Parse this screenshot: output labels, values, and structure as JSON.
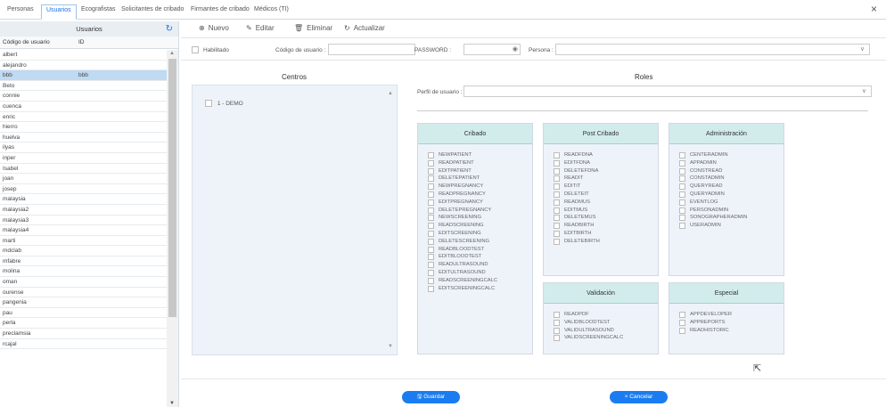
{
  "tabs": [
    "Personas",
    "Usuarios",
    "Ecografistas",
    "Solicitantes de cribado",
    "Firmantes de cribado",
    "Médicos (TI)"
  ],
  "active_tab": "Usuarios",
  "close_glyph": "×",
  "left": {
    "title": "Usuarios",
    "col_user": "Código de usuario",
    "col_id": "ID",
    "users": [
      "albert",
      "alejandro",
      "bbb",
      "Beto",
      "connie",
      "cuenca",
      "enric",
      "hierro",
      "huelva",
      "ilyas",
      "inper",
      "Isabel",
      "joan",
      "josep",
      "malaysia",
      "malaysia2",
      "malaysia3",
      "malaysia4",
      "marti",
      "mdclab",
      "mfabre",
      "molina",
      "oman",
      "ourense",
      "pangenia",
      "pau",
      "perla",
      "preclamsia",
      "rcajal"
    ],
    "selected_user": "bbb",
    "selected_id": "bbb"
  },
  "toolbar": {
    "new": "Nuevo",
    "edit": "Editar",
    "delete": "Eliminar",
    "refresh": "Actualizar"
  },
  "form": {
    "enabled_label": "Habilitado",
    "user_code_label": "Código de usuario :",
    "password_label": "PASSWORD :",
    "person_label": "Persona :",
    "profile_label": "Perfil de usuario :"
  },
  "centros": {
    "title": "Centros",
    "items": [
      "1 - DEMO"
    ]
  },
  "roles": {
    "title": "Roles",
    "groups": [
      {
        "name": "Cribado",
        "items": [
          "NEWPATIENT",
          "READPATIENT",
          "EDITPATIENT",
          "DELETEPATIENT",
          "NEWPREGNANCY",
          "READPREGNANCY",
          "EDITPREGNANCY",
          "DELETEPREGNANCY",
          "NEWSCREENING",
          "READSCREENING",
          "EDITSCREENING",
          "DELETESCREENING",
          "READBLOODTEST",
          "EDITBLOODTEST",
          "READULTRASOUND",
          "EDITULTRASOUND",
          "READSCREENINGCALC",
          "EDITSCREENINGCALC"
        ]
      },
      {
        "name": "Post Cribado",
        "items": [
          "READFDNA",
          "EDITFDNA",
          "DELETEFDNA",
          "READIT",
          "EDITIT",
          "DELETEIT",
          "READMUS",
          "EDITMUS",
          "DELETEMUS",
          "READBIRTH",
          "EDITBIRTH",
          "DELETEBIRTH"
        ]
      },
      {
        "name": "Administración",
        "items": [
          "CENTERADMIN",
          "APPADMIN",
          "CONSTREAD",
          "CONSTADMIN",
          "QUERYREAD",
          "QUERYADMIN",
          "EVENTLOG",
          "PERSONADMIN",
          "SONOGRAPHERADMIN",
          "USERADMIN"
        ]
      },
      {
        "name": "Validación",
        "items": [
          "READPDF",
          "VALIDBLOODTEST",
          "VALIDULTRASOUND",
          "VALIDSCREENINGCALC"
        ]
      },
      {
        "name": "Especial",
        "items": [
          "APPDEVELOPER",
          "APPREPORTS",
          "READHISTORIC"
        ]
      }
    ]
  },
  "buttons": {
    "save": "Guardar",
    "cancel": "Cancelar"
  },
  "colors": {
    "accent": "#1a7cf0",
    "selected_row": "#bfdaf2",
    "group_header": "#d2ecec",
    "panel_bg": "#eef3fa"
  }
}
